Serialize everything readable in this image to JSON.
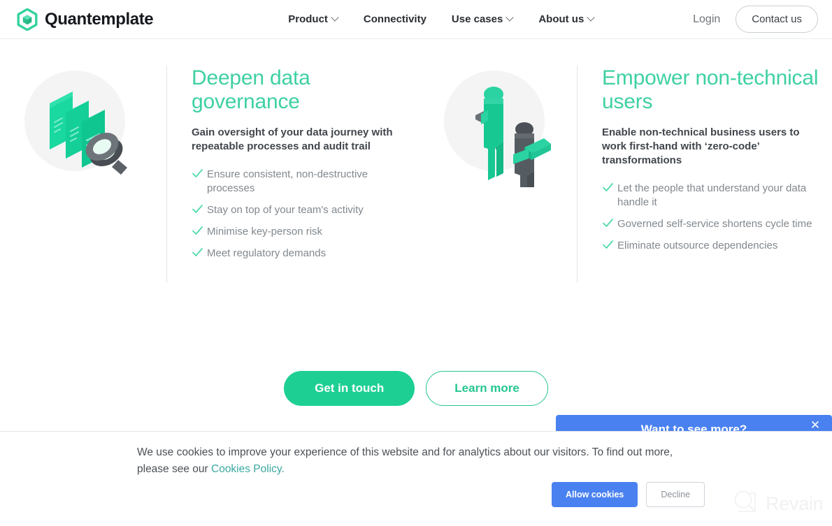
{
  "header": {
    "brand": "Quantemplate",
    "brand_icon": "hexagon-cube-logo",
    "nav": [
      {
        "label": "Product",
        "has_chevron": true
      },
      {
        "label": "Connectivity",
        "has_chevron": false
      },
      {
        "label": "Use cases",
        "has_chevron": true
      },
      {
        "label": "About us",
        "has_chevron": true
      }
    ],
    "login_label": "Login",
    "contact_label": "Contact us"
  },
  "features": [
    {
      "illustration": "documents-magnifier-icon",
      "title": "Deepen data governance",
      "subtitle": "Gain oversight of your data journey with repeatable processes and audit trail",
      "bullets": [
        "Ensure consistent, non-destructive processes",
        "Stay on top of your team's activity",
        "Minimise key-person risk",
        "Meet regulatory demands"
      ]
    },
    {
      "illustration": "two-people-icon",
      "title": "Empower non-technical users",
      "subtitle": "Enable non-technical business users to work first-hand with ‘zero-code’ transformations",
      "bullets": [
        "Let the people that understand your data handle it",
        "Governed self-service shortens cycle time",
        "Eliminate outsource dependencies"
      ]
    }
  ],
  "cta": {
    "primary_label": "Get in touch",
    "secondary_label": "Learn more"
  },
  "promo": {
    "title": "Want to see more?",
    "close_icon": "close-icon",
    "close_glyph": "✕"
  },
  "cookies": {
    "text_before_link": "We use cookies to improve your experience of this website and for analytics about our visitors. To find out more, please see our ",
    "link_label": "Cookies Policy.",
    "allow_label": "Allow cookies",
    "decline_label": "Decline"
  },
  "watermark": {
    "text": "Revain",
    "icon": "revain-magnifier-logo"
  },
  "colors": {
    "brand_green": "#3ed0a3",
    "button_green": "#1ecf93",
    "promo_blue": "#4a81f0",
    "cookie_link": "#3aa9a0",
    "body_text": "#82888e"
  }
}
